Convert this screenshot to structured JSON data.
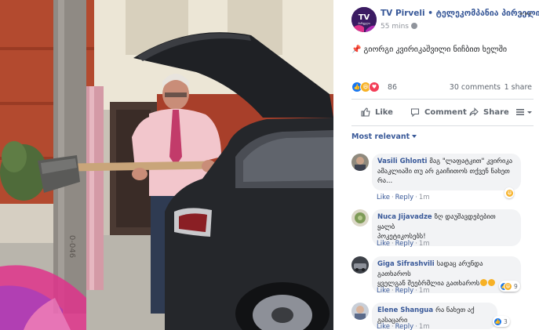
{
  "post": {
    "page_name": "TV Pirveli",
    "separator": "•",
    "page_subname": "ტელეკომპანია პირველი",
    "time": "55 mins",
    "logo_text_top": "TV",
    "logo_text_bottom": "პირველი",
    "text": "გიორგი კვირიკაშვილი ნიჩბით ხელში",
    "reactions": [
      "like-icon",
      "haha-icon",
      "love-icon"
    ],
    "reaction_count": "86",
    "comment_count": "30 comments",
    "share_count": "1 share"
  },
  "actions": {
    "like": "Like",
    "comment": "Comment",
    "share": "Share"
  },
  "sort_label": "Most relevant",
  "comments": [
    {
      "name": "Vasili Ghlonti",
      "lines": [
        "მაგ \"ლაფატკით\" კვირიკა",
        "ამაკლიაში თუ არ გაიჩითოს თქვენ ნახეთ",
        "რა..."
      ],
      "like": "Like",
      "reply": "Reply",
      "time": "1m",
      "reaction_count": ""
    },
    {
      "name": "Nuca Jijavadze",
      "lines": [
        "ზღ დაუშავდებებით ყალბ",
        "პოკეტიკოსებს!"
      ],
      "like": "Like",
      "reply": "Reply",
      "time": "1m",
      "reaction_count": ""
    },
    {
      "name": "Giga Sifrashvili",
      "lines": [
        "სადაც არუნდა გათხაროს",
        "ყველგან შეებრმლია გათხაროს"
      ],
      "like": "Like",
      "reply": "Reply",
      "time": "1m",
      "reaction_count": "9"
    },
    {
      "name": "Elene Shangua",
      "lines": [
        "რა ნახეთ აქ გასაცარი"
      ],
      "like": "Like",
      "reply": "Reply",
      "time": "1m",
      "reaction_count": "3"
    }
  ],
  "media": {
    "pole_marking": "0-046"
  },
  "colors": {
    "link_blue": "#385898",
    "text_gray": "#606770",
    "bubble_gray": "#f2f3f5",
    "like_blue": "#1877f2",
    "haha_yellow": "#f7b125",
    "love_red": "#f33e58",
    "logo_purple": "#3b1b62"
  }
}
